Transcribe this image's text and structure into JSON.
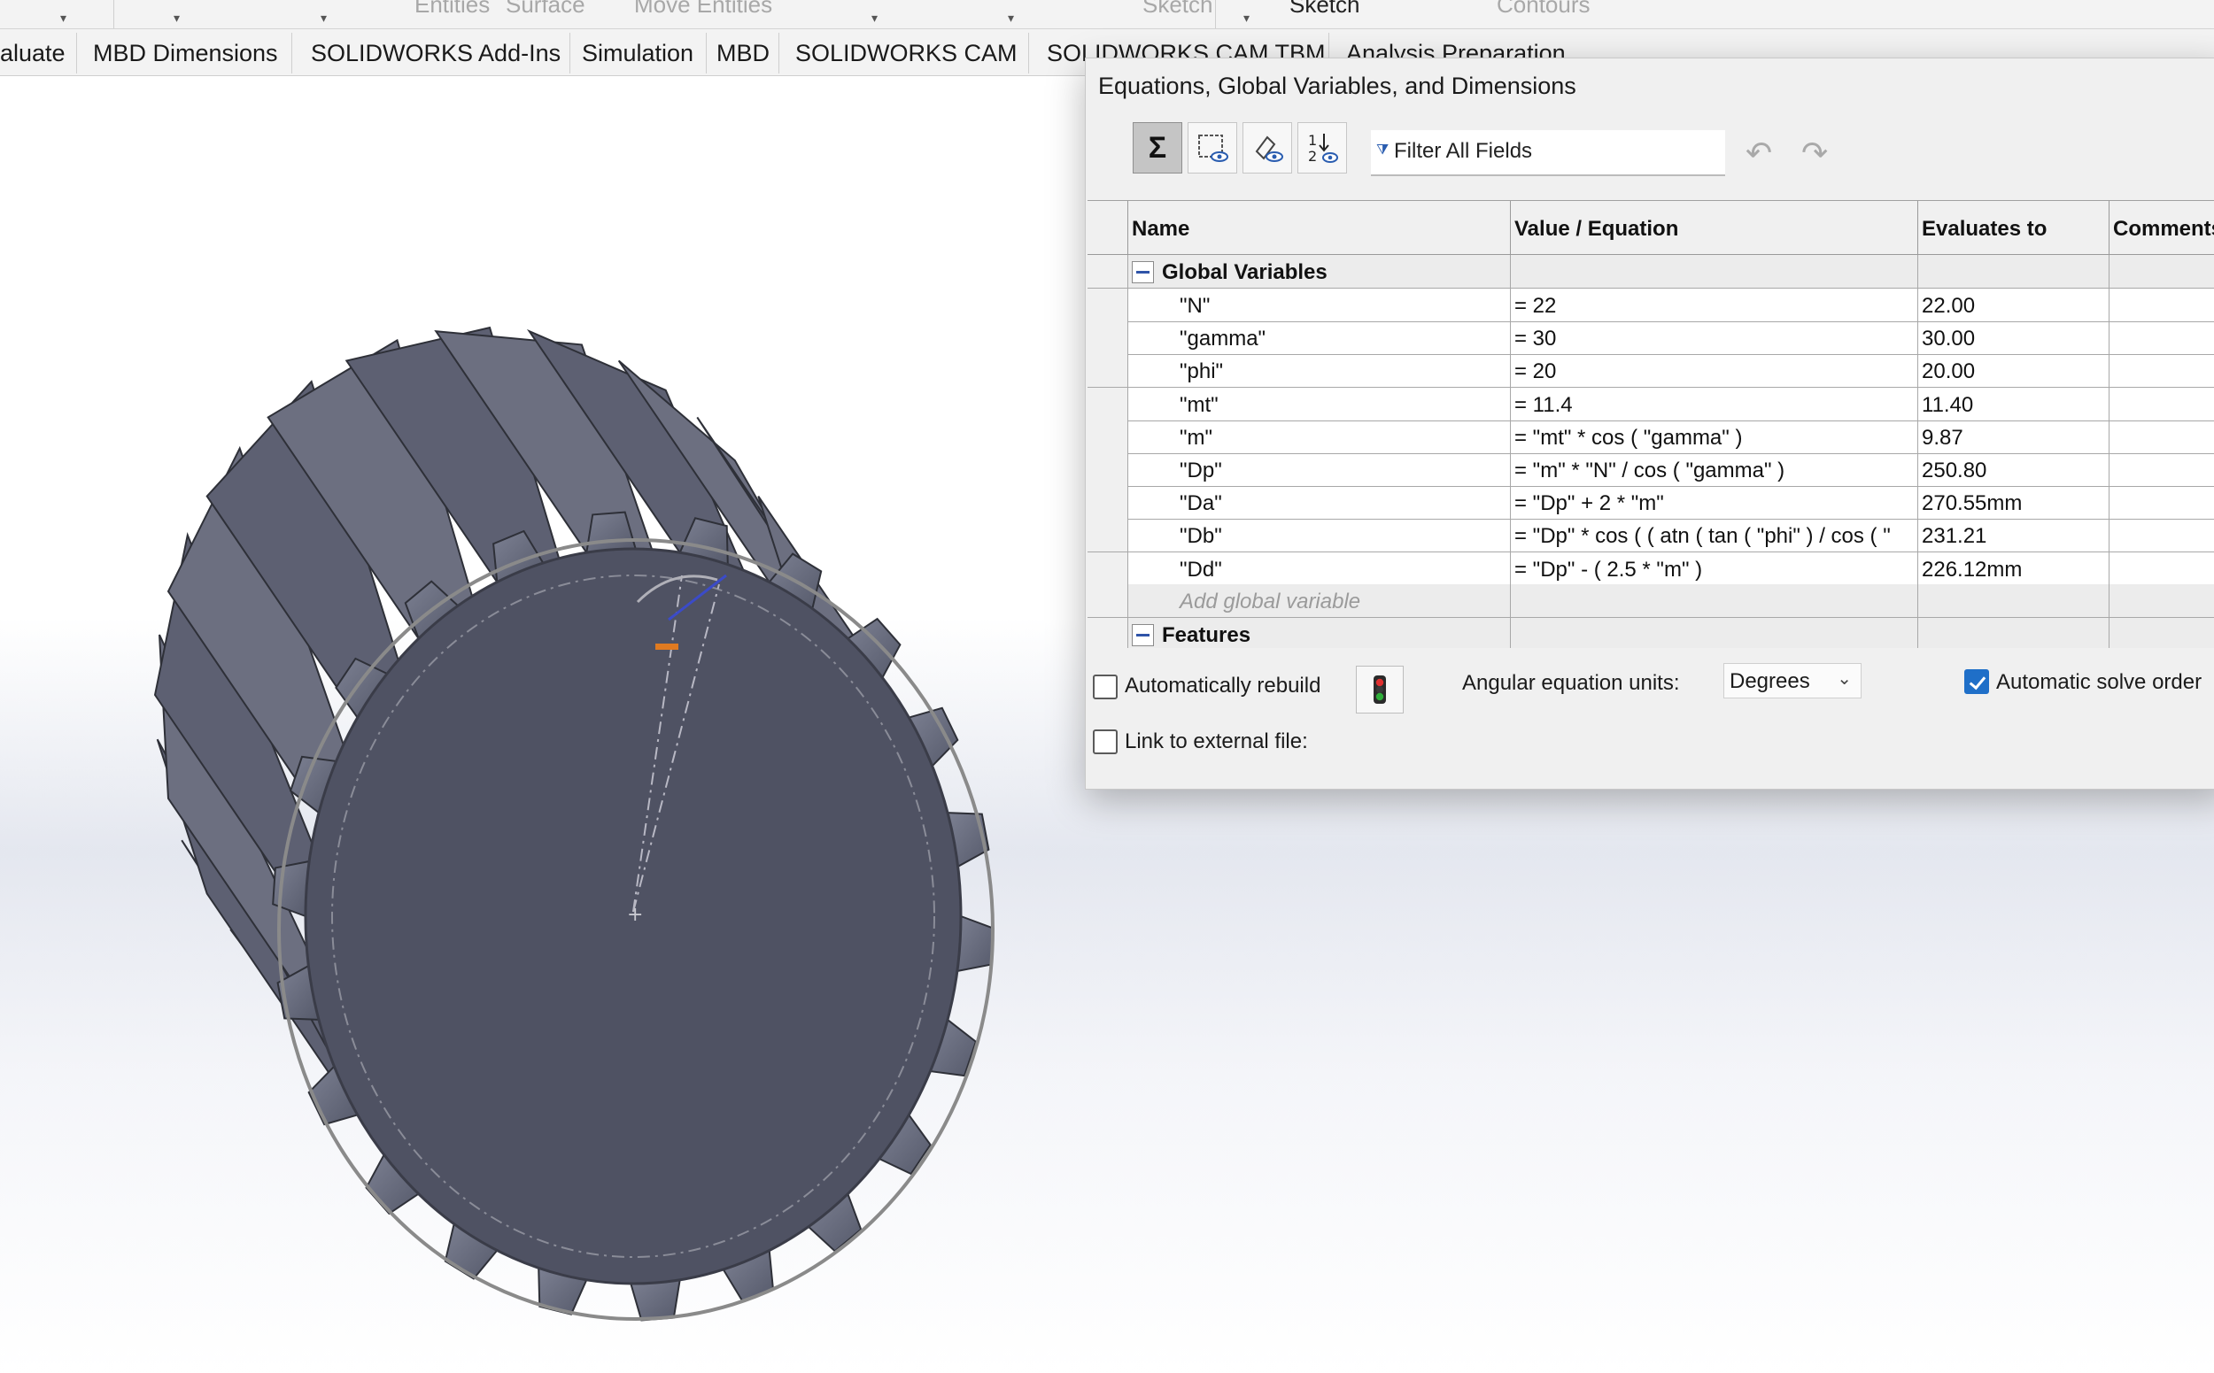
{
  "ribbon_top": {
    "labels": [
      "Entities",
      "Surface",
      "Move Entities",
      "Sketch",
      "Sketch",
      "Contours"
    ]
  },
  "tabs": [
    "aluate",
    "MBD Dimensions",
    "SOLIDWORKS Add-Ins",
    "Simulation",
    "MBD",
    "SOLIDWORKS CAM",
    "SOLIDWORKS CAM TBM",
    "Analysis Preparation"
  ],
  "dialog": {
    "title": "Equations, Global Variables, and Dimensions",
    "toolbar": {
      "buttons": [
        "equation-view-icon",
        "sketch-equation-view-icon",
        "dimension-view-icon",
        "ordered-view-icon"
      ],
      "filter_text": "Filter All Fields",
      "undo": "undo-icon",
      "redo": "redo-icon"
    },
    "table": {
      "headers": [
        "Name",
        "Value / Equation",
        "Evaluates to",
        "Comments"
      ],
      "global_group_label": "Global Variables",
      "rows": [
        {
          "name": "\"N\"",
          "value": "= 22",
          "evaluates": "22.00"
        },
        {
          "name": "\"gamma\"",
          "value": "= 30",
          "evaluates": "30.00"
        },
        {
          "name": "\"phi\"",
          "value": "= 20",
          "evaluates": "20.00"
        },
        {
          "name": "\"mt\"",
          "value": "= 11.4",
          "evaluates": "11.40"
        },
        {
          "name": "\"m\"",
          "value": "= \"mt\" * cos ( \"gamma\" )",
          "evaluates": "9.87"
        },
        {
          "name": "\"Dp\"",
          "value": "= \"m\" * \"N\" / cos ( \"gamma\" )",
          "evaluates": "250.80"
        },
        {
          "name": "\"Da\"",
          "value": "= \"Dp\" + 2 * \"m\"",
          "evaluates": "270.55mm"
        },
        {
          "name": "\"Db\"",
          "value": "= \"Dp\" * cos ( ( atn ( tan ( \"phi\" ) / cos ( \"",
          "evaluates": "231.21"
        },
        {
          "name": "\"Dd\"",
          "value": "= \"Dp\" - ( 2.5 * \"m\" )",
          "evaluates": "226.12mm"
        }
      ],
      "add_placeholder": "Add global variable",
      "features_group_label": "Features"
    },
    "options": {
      "auto_rebuild_label": "Automatically rebuild",
      "auto_rebuild_checked": false,
      "angular_units_label": "Angular equation units:",
      "angular_units_value": "Degrees",
      "auto_solve_label": "Automatic solve order",
      "auto_solve_checked": true,
      "link_external_label": "Link to external file:",
      "link_external_checked": false
    }
  },
  "colors": {
    "gear_body": "#4f5263",
    "gear_tooth": "#6a6d7e",
    "check_accent": "#1f6fc8"
  }
}
